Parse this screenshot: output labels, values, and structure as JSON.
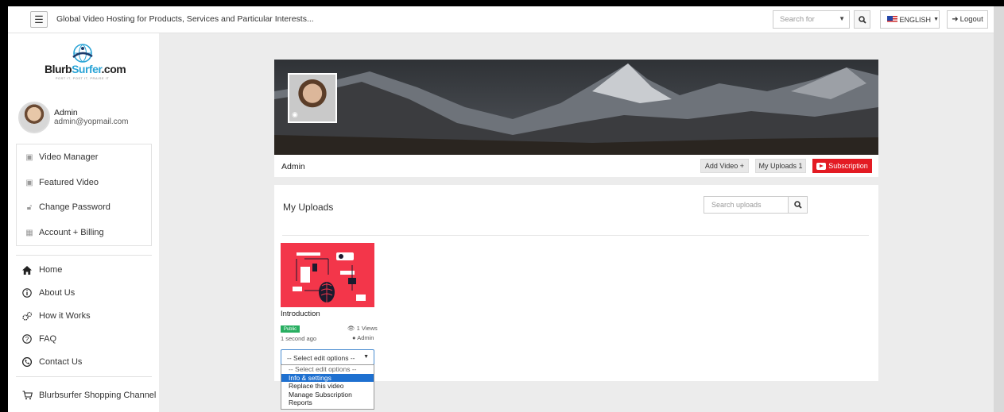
{
  "topbar": {
    "site_title": "Global Video Hosting for Products, Services and Particular Interests...",
    "search_placeholder": "Search for",
    "language": "ENGLISH",
    "logout": "Logout"
  },
  "sidebar": {
    "logo": {
      "name_part1": "Blurb",
      "name_part2": "Surfer",
      "name_part3": ".com",
      "tagline": "POST IT, POST IT, PRAISE IT"
    },
    "profile": {
      "name": "Admin",
      "email": "admin@yopmail.com"
    },
    "account_menu": [
      {
        "label": "Video Manager",
        "icon": "video-icon"
      },
      {
        "label": "Featured Video",
        "icon": "video-icon"
      },
      {
        "label": "Change Password",
        "icon": "lock-icon"
      },
      {
        "label": "Account + Billing",
        "icon": "building-icon"
      }
    ],
    "nav": [
      {
        "label": "Home",
        "icon": "home-icon"
      },
      {
        "label": "About Us",
        "icon": "info-icon"
      },
      {
        "label": "How it Works",
        "icon": "gears-icon"
      },
      {
        "label": "FAQ",
        "icon": "question-icon"
      },
      {
        "label": "Contact Us",
        "icon": "phone-icon"
      }
    ],
    "shopping": {
      "label": "Blurbsurfer Shopping Channel",
      "icon": "cart-icon"
    }
  },
  "channel": {
    "name": "Admin",
    "add_video": "Add Video +",
    "my_uploads": "My Uploads 1",
    "subscription": "Subscription"
  },
  "uploads": {
    "title": "My Uploads",
    "search_placeholder": "Search uploads",
    "videos": [
      {
        "title": "Introduction",
        "status": "Public",
        "views": "1 Views",
        "age": "1 second ago",
        "uploader": "Admin",
        "select_value": "-- Select edit options --"
      }
    ],
    "edit_options": [
      "-- Select edit options --",
      "Info & settings",
      "Replace this video",
      "Manage Subscription",
      "Reports"
    ],
    "highlighted_option": "Info & settings"
  },
  "colors": {
    "subscription_red": "#e31b23",
    "public_green": "#27ae60",
    "thumb_red": "#f3364a",
    "highlight_blue": "#1e70d0",
    "logo_blue": "#2aa4d6"
  }
}
